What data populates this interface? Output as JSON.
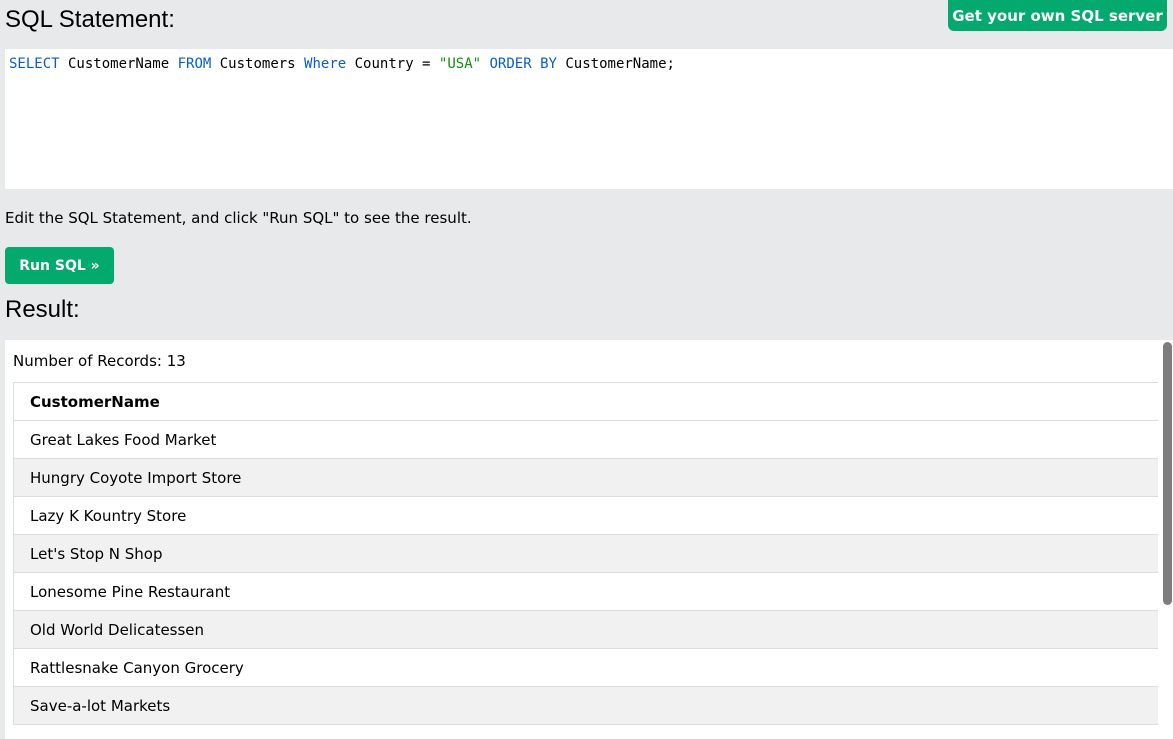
{
  "header": {
    "sql_title": "SQL Statement:",
    "get_server_label": "Get your own SQL server"
  },
  "editor": {
    "tokens": [
      {
        "text": "SELECT",
        "kind": "keyword"
      },
      {
        "text": " CustomerName ",
        "kind": "plain"
      },
      {
        "text": "FROM",
        "kind": "keyword"
      },
      {
        "text": " Customers ",
        "kind": "plain"
      },
      {
        "text": "Where",
        "kind": "keyword"
      },
      {
        "text": " Country = ",
        "kind": "plain"
      },
      {
        "text": "\"USA\"",
        "kind": "string"
      },
      {
        "text": " ",
        "kind": "plain"
      },
      {
        "text": "ORDER BY",
        "kind": "keyword"
      },
      {
        "text": " CustomerName;",
        "kind": "plain"
      }
    ]
  },
  "hint": "Edit the SQL Statement, and click \"Run SQL\" to see the result.",
  "run_button_label": "Run SQL »",
  "result": {
    "title": "Result:",
    "record_count": "Number of Records: 13",
    "column_header": "CustomerName",
    "rows": [
      "Great Lakes Food Market",
      "Hungry Coyote Import Store",
      "Lazy K Kountry Store",
      "Let's Stop N Shop",
      "Lonesome Pine Restaurant",
      "Old World Delicatessen",
      "Rattlesnake Canyon Grocery",
      "Save-a-lot Markets"
    ]
  },
  "colors": {
    "accent_green": "#04aa6d",
    "page_background": "#e7e9eb",
    "sql_keyword": "#0a5cce",
    "sql_string": "#118d11",
    "row_stripe": "#f1f1f1"
  }
}
